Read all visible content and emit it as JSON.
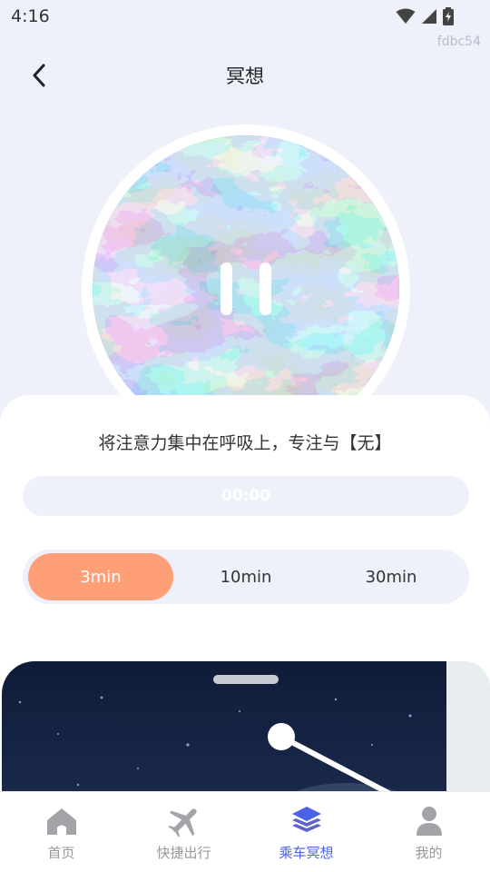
{
  "status_bar": {
    "time": "4:16",
    "watermark": "fdbc54"
  },
  "header": {
    "title": "冥想"
  },
  "player": {
    "prompt": "将注意力集中在呼吸上，专注与【无】",
    "timer": "00:00"
  },
  "durations": [
    {
      "label": "3min",
      "selected": true
    },
    {
      "label": "10min",
      "selected": false
    },
    {
      "label": "30min",
      "selected": false
    }
  ],
  "tabs": [
    {
      "label": "首页",
      "icon": "home-icon"
    },
    {
      "label": "快捷出行",
      "icon": "airplane-icon"
    },
    {
      "label": "乘车冥想",
      "icon": "layers-icon",
      "active": true
    },
    {
      "label": "我的",
      "icon": "user-icon"
    }
  ],
  "colors": {
    "accent": "#ff9f78",
    "active_tab": "#4a63e6",
    "background": "#eef0fa"
  }
}
